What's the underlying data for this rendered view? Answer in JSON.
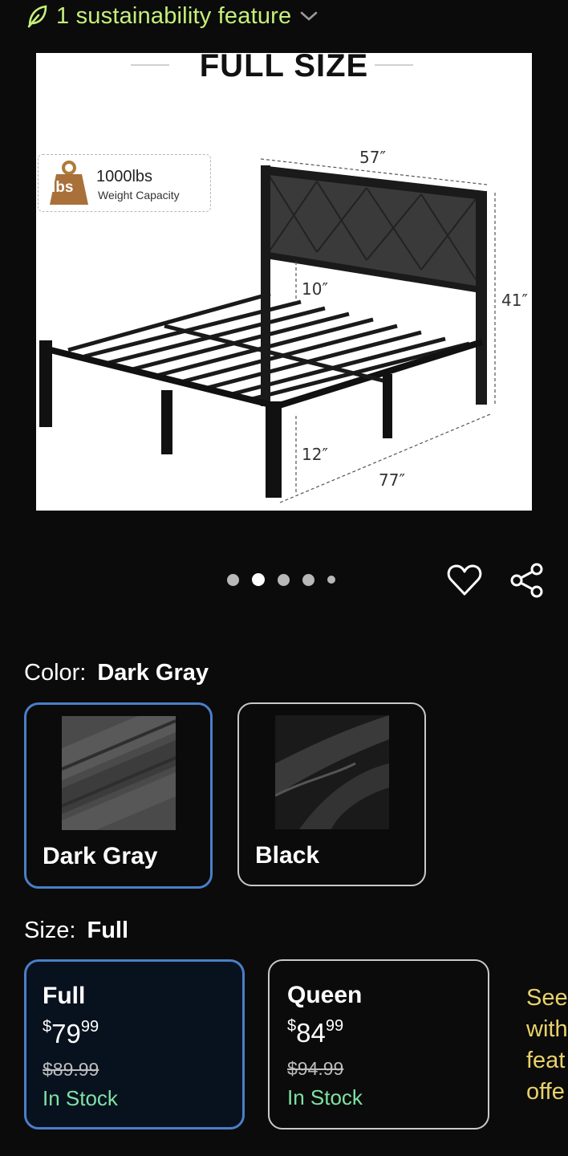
{
  "sustainability": {
    "text": "1 sustainability feature",
    "icon": "leaf-icon"
  },
  "product_image": {
    "title": "FULL SIZE",
    "weight_value": "1000lbs",
    "weight_label": "Weight Capacity",
    "weight_icon_text": "lbs",
    "dims": {
      "width": "57″",
      "height": "41″",
      "clearance": "10″",
      "leg": "12″",
      "length": "77″"
    }
  },
  "carousel": {
    "total": 5,
    "active_index": 1
  },
  "color": {
    "label": "Color:",
    "selected": "Dark Gray",
    "options": [
      {
        "name": "Dark Gray",
        "selected": true
      },
      {
        "name": "Black",
        "selected": false
      }
    ]
  },
  "size": {
    "label": "Size:",
    "selected": "Full",
    "options": [
      {
        "name": "Full",
        "currency": "$",
        "dollars": "79",
        "cents": "99",
        "was": "$89.99",
        "stock": "In Stock",
        "selected": true
      },
      {
        "name": "Queen",
        "currency": "$",
        "dollars": "84",
        "cents": "99",
        "was": "$94.99",
        "stock": "In Stock",
        "selected": false
      }
    ]
  },
  "see_more": {
    "lines": [
      "See",
      "with",
      "feat",
      "offe"
    ]
  },
  "colors": {
    "accent": "#4a7fc8",
    "sustainability": "#c6ef7a",
    "stock": "#7ee2a3",
    "link": "#e8d26b"
  }
}
